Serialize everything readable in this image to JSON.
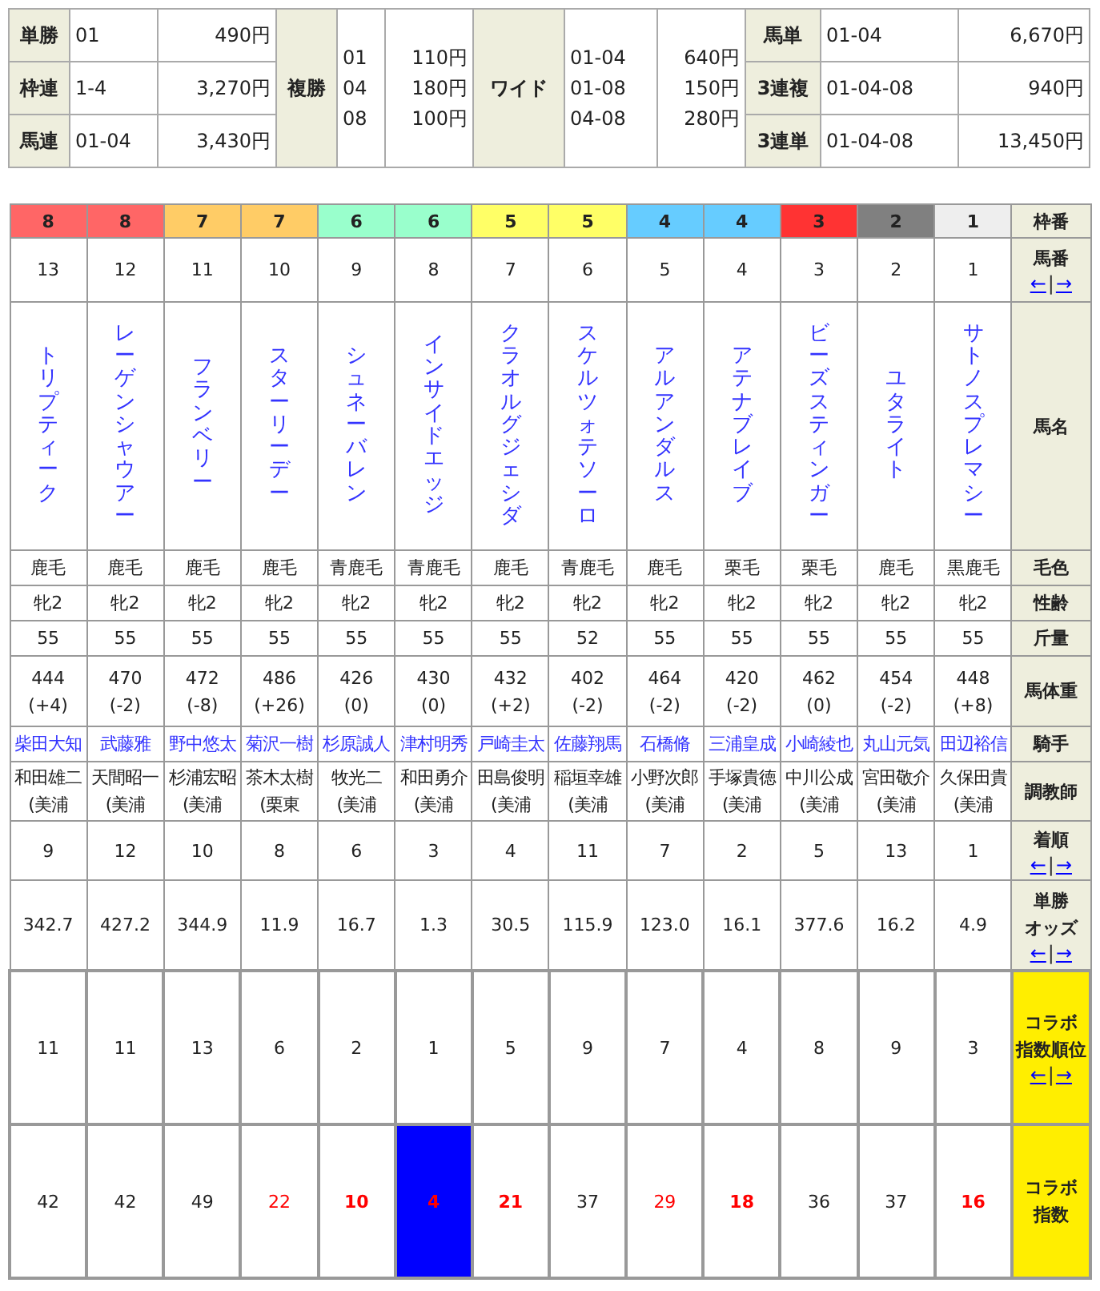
{
  "payouts": {
    "left": [
      {
        "label": "単勝",
        "combo": "01",
        "amount": "490円"
      },
      {
        "label": "枠連",
        "combo": "1-4",
        "amount": "3,270円"
      },
      {
        "label": "馬連",
        "combo": "01-04",
        "amount": "3,430円"
      }
    ],
    "place": {
      "label": "複勝",
      "rows": [
        {
          "combo": "01",
          "amount": "110円"
        },
        {
          "combo": "04",
          "amount": "180円"
        },
        {
          "combo": "08",
          "amount": "100円"
        }
      ]
    },
    "wide": {
      "label": "ワイド",
      "rows": [
        {
          "combo": "01-04",
          "amount": "640円"
        },
        {
          "combo": "01-08",
          "amount": "150円"
        },
        {
          "combo": "04-08",
          "amount": "280円"
        }
      ]
    },
    "right": [
      {
        "label": "馬単",
        "combo": "01-04",
        "amount": "6,670円"
      },
      {
        "label": "3連複",
        "combo": "01-04-08",
        "amount": "940円"
      },
      {
        "label": "3連単",
        "combo": "01-04-08",
        "amount": "13,450円"
      }
    ]
  },
  "row_headers": [
    {
      "kind": "frame",
      "label": "枠番",
      "highlight": false
    },
    {
      "kind": "number",
      "label": "馬番",
      "highlight": false,
      "sort_links": [
        {
          "text": "←",
          "kind": "link"
        },
        {
          "text": "|",
          "kind": "sep"
        },
        {
          "text": "→",
          "kind": "link"
        }
      ]
    },
    {
      "kind": "name",
      "label": "馬名",
      "highlight": false
    },
    {
      "kind": "coat",
      "label": "毛色",
      "highlight": false
    },
    {
      "kind": "sex_age",
      "label": "性齢",
      "highlight": false
    },
    {
      "kind": "weight",
      "label": "斤量",
      "highlight": false
    },
    {
      "kind": "body_weight",
      "label": "馬体重",
      "highlight": false
    },
    {
      "kind": "jockey",
      "label": "騎手",
      "highlight": false
    },
    {
      "kind": "trainer",
      "label": "調教師",
      "highlight": false
    },
    {
      "kind": "finish",
      "label": "着順",
      "highlight": false,
      "sort_links": [
        {
          "text": "←",
          "kind": "link"
        },
        {
          "text": "|",
          "kind": "sep"
        },
        {
          "text": "→",
          "kind": "link"
        }
      ]
    },
    {
      "kind": "odds",
      "label_lines": [
        "単勝",
        "オッズ"
      ],
      "highlight": false,
      "sort_links": [
        {
          "text": "←",
          "kind": "link"
        },
        {
          "text": "|",
          "kind": "sep"
        },
        {
          "text": "→",
          "kind": "link"
        }
      ]
    },
    {
      "kind": "collab_rank",
      "label_lines": [
        "コラボ",
        "指数順位"
      ],
      "highlight": true,
      "sort_links": [
        {
          "text": "←",
          "kind": "link"
        },
        {
          "text": "|",
          "kind": "sep"
        },
        {
          "text": "→",
          "kind": "link"
        }
      ]
    },
    {
      "kind": "collab_index",
      "label_lines": [
        "コラボ",
        "指数"
      ],
      "highlight": true
    }
  ],
  "horses": [
    {
      "frame": "8",
      "color": "#ff6666",
      "number": "13",
      "name": "トリプティーク",
      "coat": "鹿毛",
      "sex_age": "牝2",
      "weight": "55",
      "body_weight": "444",
      "change": "(+4)",
      "jockey": "柴田大知",
      "trainer": "和田雄二",
      "stable": "(美浦",
      "finish": "9",
      "odds": "342.7",
      "collab_rank": "11",
      "collab_index": "42",
      "emphasis": false,
      "strong": false,
      "selected": false
    },
    {
      "frame": "8",
      "color": "#ff6666",
      "number": "12",
      "name": "レーゲンシャウアー",
      "coat": "鹿毛",
      "sex_age": "牝2",
      "weight": "55",
      "body_weight": "470",
      "change": "(-2)",
      "jockey": "武藤雅",
      "trainer": "天間昭一",
      "stable": "(美浦",
      "finish": "12",
      "odds": "427.2",
      "collab_rank": "11",
      "collab_index": "42",
      "emphasis": false,
      "strong": false,
      "selected": false
    },
    {
      "frame": "7",
      "color": "#ffcc66",
      "number": "11",
      "name": "フランベリー",
      "coat": "鹿毛",
      "sex_age": "牝2",
      "weight": "55",
      "body_weight": "472",
      "change": "(-8)",
      "jockey": "野中悠太",
      "trainer": "杉浦宏昭",
      "stable": "(美浦",
      "finish": "10",
      "odds": "344.9",
      "collab_rank": "13",
      "collab_index": "49",
      "emphasis": false,
      "strong": false,
      "selected": false
    },
    {
      "frame": "7",
      "color": "#ffcc66",
      "number": "10",
      "name": "スターリーデー",
      "coat": "鹿毛",
      "sex_age": "牝2",
      "weight": "55",
      "body_weight": "486",
      "change": "(+26)",
      "jockey": "菊沢一樹",
      "trainer": "茶木太樹",
      "stable": "(栗東",
      "finish": "8",
      "odds": "11.9",
      "collab_rank": "6",
      "collab_index": "22",
      "emphasis": true,
      "strong": false,
      "selected": false
    },
    {
      "frame": "6",
      "color": "#99ffcc",
      "number": "9",
      "name": "シュネーバレン",
      "coat": "青鹿毛",
      "sex_age": "牝2",
      "weight": "55",
      "body_weight": "426",
      "change": "(0)",
      "jockey": "杉原誠人",
      "trainer": "牧光二",
      "stable": "(美浦",
      "finish": "6",
      "odds": "16.7",
      "collab_rank": "2",
      "collab_index": "10",
      "emphasis": true,
      "strong": true,
      "selected": false
    },
    {
      "frame": "6",
      "color": "#99ffcc",
      "number": "8",
      "name": "インサイドエッジ",
      "coat": "青鹿毛",
      "sex_age": "牝2",
      "weight": "55",
      "body_weight": "430",
      "change": "(0)",
      "jockey": "津村明秀",
      "trainer": "和田勇介",
      "stable": "(美浦",
      "finish": "3",
      "odds": "1.3",
      "collab_rank": "1",
      "collab_index": "4",
      "emphasis": true,
      "strong": true,
      "selected": true
    },
    {
      "frame": "5",
      "color": "#ffff66",
      "number": "7",
      "name": "クラオルグジェシダ",
      "coat": "鹿毛",
      "sex_age": "牝2",
      "weight": "55",
      "body_weight": "432",
      "change": "(+2)",
      "jockey": "戸崎圭太",
      "trainer": "田島俊明",
      "stable": "(美浦",
      "finish": "4",
      "odds": "30.5",
      "collab_rank": "5",
      "collab_index": "21",
      "emphasis": true,
      "strong": true,
      "selected": false
    },
    {
      "frame": "5",
      "color": "#ffff66",
      "number": "6",
      "name": "スケルツォテソーロ",
      "coat": "青鹿毛",
      "sex_age": "牝2",
      "weight": "52",
      "body_weight": "402",
      "change": "(-2)",
      "jockey": "佐藤翔馬",
      "trainer": "稲垣幸雄",
      "stable": "(美浦",
      "finish": "11",
      "odds": "115.9",
      "collab_rank": "9",
      "collab_index": "37",
      "emphasis": false,
      "strong": false,
      "selected": false
    },
    {
      "frame": "4",
      "color": "#66ccff",
      "number": "5",
      "name": "アルアンダルス",
      "coat": "鹿毛",
      "sex_age": "牝2",
      "weight": "55",
      "body_weight": "464",
      "change": "(-2)",
      "jockey": "石橋脩",
      "trainer": "小野次郎",
      "stable": "(美浦",
      "finish": "7",
      "odds": "123.0",
      "collab_rank": "7",
      "collab_index": "29",
      "emphasis": true,
      "strong": false,
      "selected": false
    },
    {
      "frame": "4",
      "color": "#66ccff",
      "number": "4",
      "name": "アテナブレイブ",
      "coat": "栗毛",
      "sex_age": "牝2",
      "weight": "55",
      "body_weight": "420",
      "change": "(-2)",
      "jockey": "三浦皇成",
      "trainer": "手塚貴徳",
      "stable": "(美浦",
      "finish": "2",
      "odds": "16.1",
      "collab_rank": "4",
      "collab_index": "18",
      "emphasis": true,
      "strong": true,
      "selected": false
    },
    {
      "frame": "3",
      "color": "#ff3333",
      "number": "3",
      "name": "ビーズスティンガー",
      "coat": "栗毛",
      "sex_age": "牝2",
      "weight": "55",
      "body_weight": "462",
      "change": "(0)",
      "jockey": "小崎綾也",
      "trainer": "中川公成",
      "stable": "(美浦",
      "finish": "5",
      "odds": "377.6",
      "collab_rank": "8",
      "collab_index": "36",
      "emphasis": false,
      "strong": false,
      "selected": false
    },
    {
      "frame": "2",
      "color": "#808080",
      "number": "2",
      "name": "ユタライト",
      "coat": "鹿毛",
      "sex_age": "牝2",
      "weight": "55",
      "body_weight": "454",
      "change": "(-2)",
      "jockey": "丸山元気",
      "trainer": "宮田敬介",
      "stable": "(美浦",
      "finish": "13",
      "odds": "16.2",
      "collab_rank": "9",
      "collab_index": "37",
      "emphasis": false,
      "strong": false,
      "selected": false
    },
    {
      "frame": "1",
      "color": "#eeeeee",
      "number": "1",
      "name": "サトノスプレマシー",
      "coat": "黒鹿毛",
      "sex_age": "牝2",
      "weight": "55",
      "body_weight": "448",
      "change": "(+8)",
      "jockey": "田辺裕信",
      "trainer": "久保田貴",
      "stable": "(美浦",
      "finish": "1",
      "odds": "4.9",
      "collab_rank": "3",
      "collab_index": "16",
      "emphasis": true,
      "strong": true,
      "selected": false
    }
  ]
}
